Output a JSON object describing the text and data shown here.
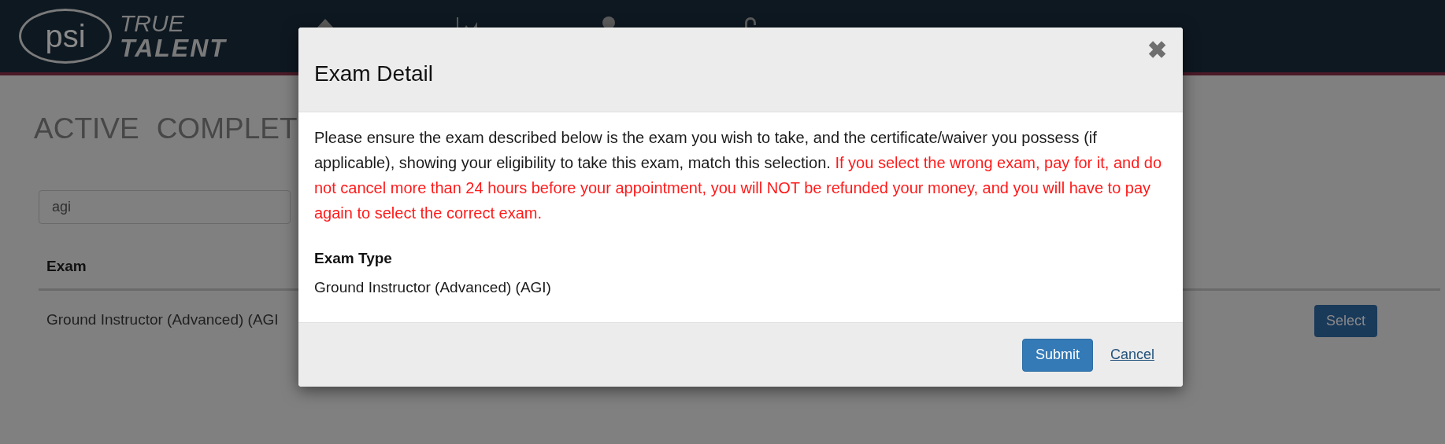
{
  "logo": {
    "mark": "psi",
    "line_1": "TRUE",
    "line_2": "TALENT"
  },
  "tabs": [
    {
      "label": "ACTIVE"
    },
    {
      "label": "COMPLET"
    }
  ],
  "search": {
    "value": "agi"
  },
  "table": {
    "columns": [
      "Exam"
    ],
    "rows": [
      {
        "cells": [
          "Ground Instructor (Advanced) (AGI"
        ],
        "action": "Select"
      }
    ]
  },
  "modal": {
    "title": "Exam Detail",
    "close": "✖",
    "intro": "Please ensure the exam described below is the exam you wish to take, and the certificate/waiver you possess (if applicable), showing your eligibility to take this exam, match this selection.",
    "warning": "If you select the wrong exam, pay for it, and do not cancel more than 24 hours before your appointment, you will NOT be refunded your money, and you will have to pay again to select the correct exam.",
    "field_label": "Exam Type",
    "field_value": "Ground Instructor (Advanced) (AGI)",
    "buttons": [
      {
        "label": "Submit",
        "kind": "primary"
      },
      {
        "label": "Cancel",
        "kind": "link"
      }
    ]
  }
}
